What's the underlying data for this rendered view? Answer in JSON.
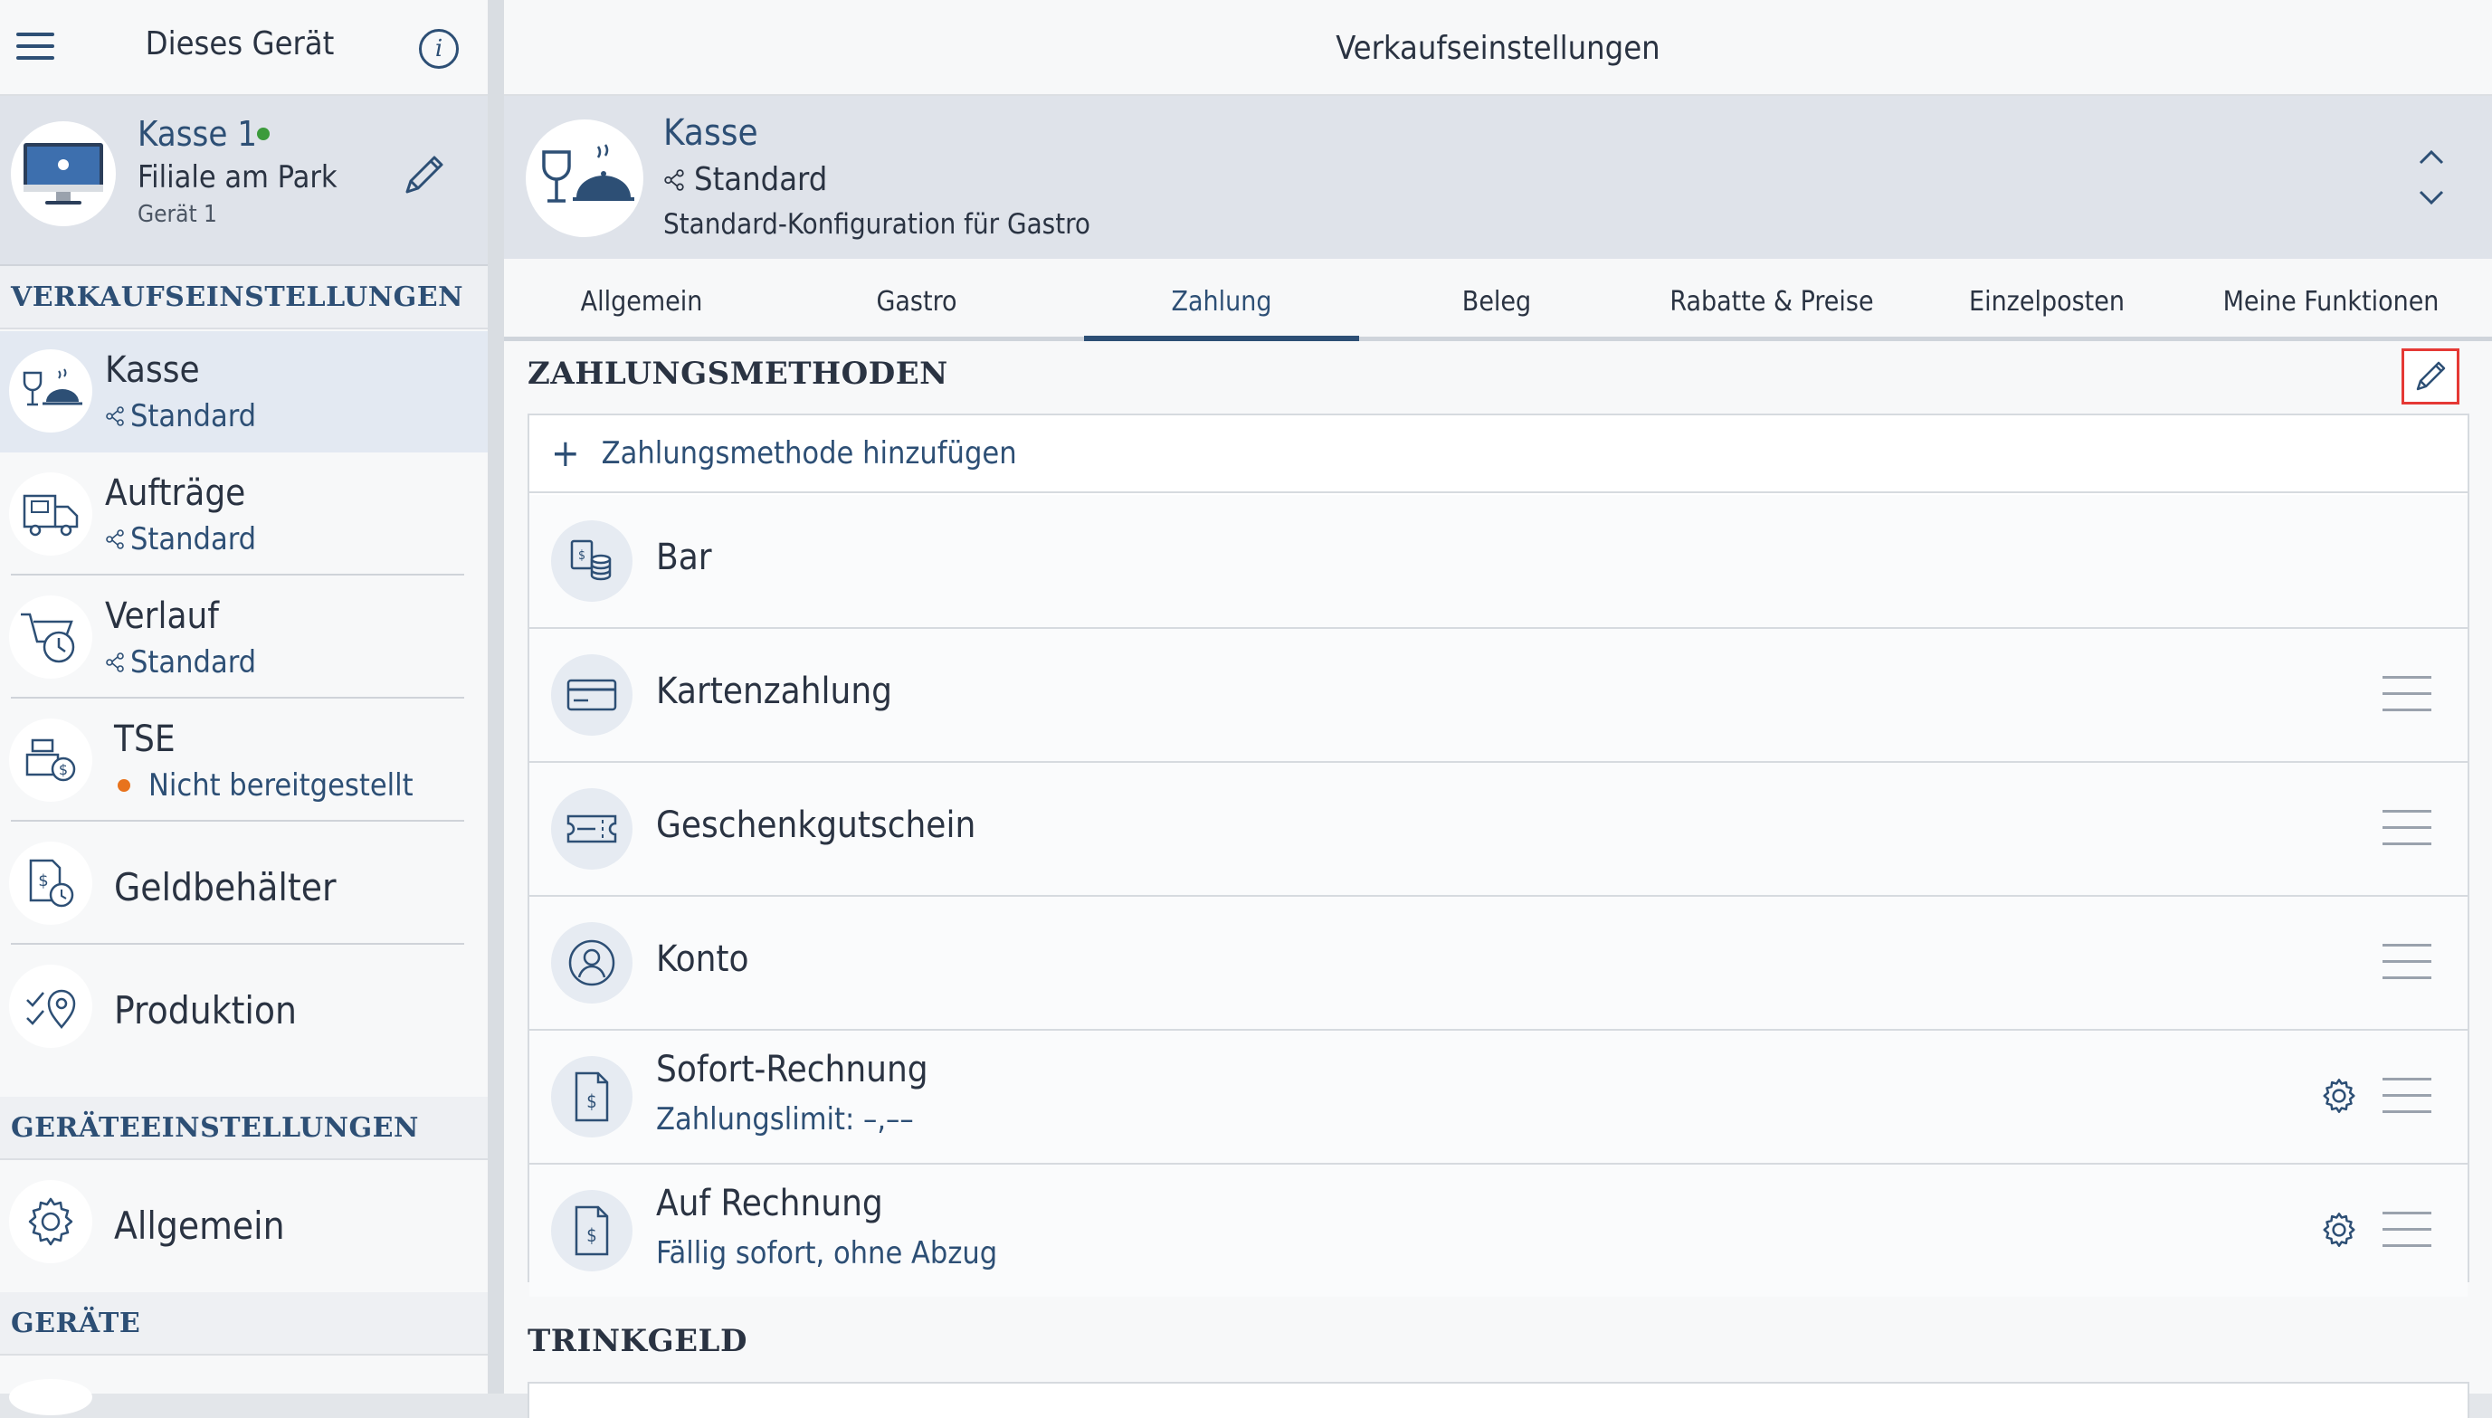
{
  "left": {
    "title": "Dieses Gerät",
    "device": {
      "name": "Kasse 1",
      "location": "Filiale am Park",
      "id": "Gerät 1",
      "status_color": "#3c9b3c"
    },
    "section_sales": "VERKAUFSEINSTELLUNGEN",
    "items": [
      {
        "label": "Kasse",
        "sub": "Standard"
      },
      {
        "label": "Aufträge",
        "sub": "Standard"
      },
      {
        "label": "Verlauf",
        "sub": "Standard"
      },
      {
        "label": "TSE",
        "sub": "Nicht bereitgestellt"
      },
      {
        "label": "Geldbehälter"
      },
      {
        "label": "Produktion"
      }
    ],
    "section_device_settings": "GERÄTEEINSTELLUNGEN",
    "device_settings_item": "Allgemein",
    "section_devices": "GERÄTE"
  },
  "right": {
    "title": "Verkaufseinstellungen",
    "header": {
      "title": "Kasse",
      "profile": "Standard",
      "description": "Standard-Konfiguration für Gastro"
    },
    "tabs": [
      "Allgemein",
      "Gastro",
      "Zahlung",
      "Beleg",
      "Rabatte & Preise",
      "Einzelposten",
      "Meine Funktionen"
    ],
    "active_tab": "Zahlung",
    "payment_section": "ZAHLUNGSMETHODEN",
    "add_payment": "Zahlungsmethode hinzufügen",
    "methods": [
      {
        "label": "Bar"
      },
      {
        "label": "Kartenzahlung"
      },
      {
        "label": "Geschenkgutschein"
      },
      {
        "label": "Konto"
      },
      {
        "label": "Sofort-Rechnung",
        "sub": "Zahlungslimit: –,––"
      },
      {
        "label": "Auf Rechnung",
        "sub": "Fällig sofort, ohne Abzug"
      }
    ],
    "tip_section": "TRINKGELD"
  },
  "colors": {
    "accent": "#2d4f75",
    "highlight_border": "#e53935",
    "warning_dot": "#e8731d"
  }
}
